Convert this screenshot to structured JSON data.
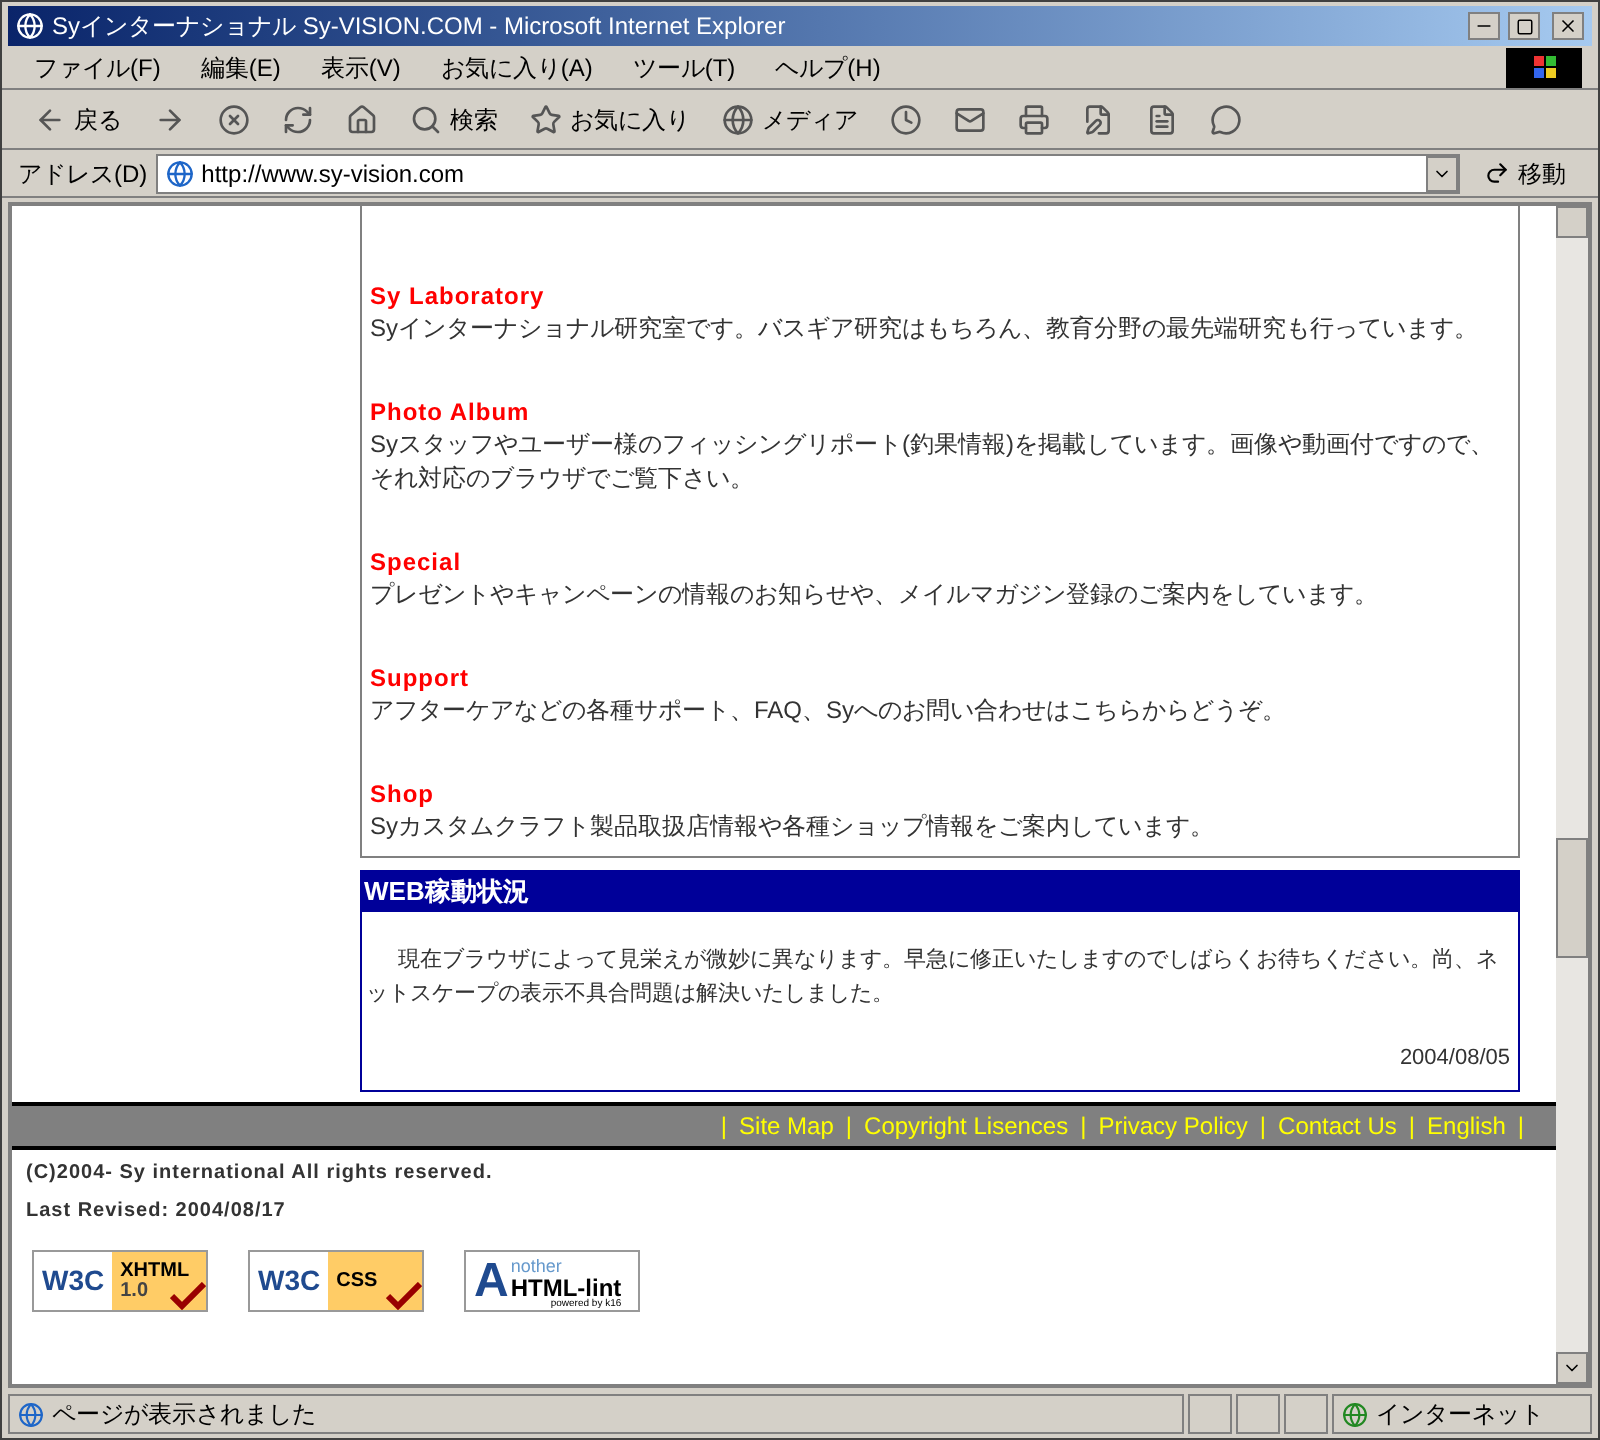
{
  "window": {
    "title": "Syインターナショナル Sy-VISION.COM - Microsoft Internet Explorer"
  },
  "menu": [
    "ファイル(F)",
    "編集(E)",
    "表示(V)",
    "お気に入り(A)",
    "ツール(T)",
    "ヘルプ(H)"
  ],
  "toolbar": [
    {
      "kind": "back",
      "label": "戻る"
    },
    {
      "kind": "forward"
    },
    {
      "kind": "stop"
    },
    {
      "kind": "refresh"
    },
    {
      "kind": "home"
    },
    {
      "kind": "search",
      "label": "検索"
    },
    {
      "kind": "favorites",
      "label": "お気に入り"
    },
    {
      "kind": "media",
      "label": "メディア"
    },
    {
      "kind": "history"
    },
    {
      "kind": "mail"
    },
    {
      "kind": "print"
    },
    {
      "kind": "edit"
    },
    {
      "kind": "discuss"
    },
    {
      "kind": "messenger"
    }
  ],
  "address": {
    "label": "アドレス(D)",
    "value": "http://www.sy-vision.com",
    "go": "移動"
  },
  "sections": [
    {
      "title": "Sy Laboratory",
      "text": "Syインターナショナル研究室です。バスギア研究はもちろん、教育分野の最先端研究も行っています。"
    },
    {
      "title": "Photo Album",
      "text": "Syスタッフやユーザー様のフィッシングリポート(釣果情報)を掲載しています。画像や動画付ですので、それ対応のブラウザでご覧下さい。"
    },
    {
      "title": "Special",
      "text": "プレゼントやキャンペーンの情報のお知らせや、メイルマガジン登録のご案内をしています。"
    },
    {
      "title": "Support",
      "text": "アフターケアなどの各種サポート、FAQ、Syへのお問い合わせはこちらからどうぞ。"
    },
    {
      "title": "Shop",
      "text": "Syカスタムクラフト製品取扱店情報や各種ショップ情報をご案内しています。"
    }
  ],
  "web_status": {
    "title": "WEB稼動状況",
    "text": "現在ブラウザによって見栄えが微妙に異なります。早急に修正いたしますのでしばらくお待ちください。尚、ネットスケープの表示不具合問題は解決いたしました。",
    "date": "2004/08/05"
  },
  "footer_links": [
    "Site Map",
    "Copyright Lisences",
    "Privacy Policy",
    "Contact Us",
    "English"
  ],
  "footer_separator": "|",
  "copyright": "(C)2004- Sy international All rights reserved.",
  "last_revised": "Last Revised: 2004/08/17",
  "badges": [
    {
      "kind": "w3c",
      "logo": "W3C",
      "line1": "XHTML",
      "line2": "1.0"
    },
    {
      "kind": "w3c",
      "logo": "W3C",
      "line1": "CSS"
    },
    {
      "kind": "lint",
      "logo": "A",
      "line1": "nother",
      "line2": "HTML-lint",
      "line3": "powered by k16"
    }
  ],
  "status_bar": {
    "text": "ページが表示されました",
    "zone": "インターネット"
  }
}
